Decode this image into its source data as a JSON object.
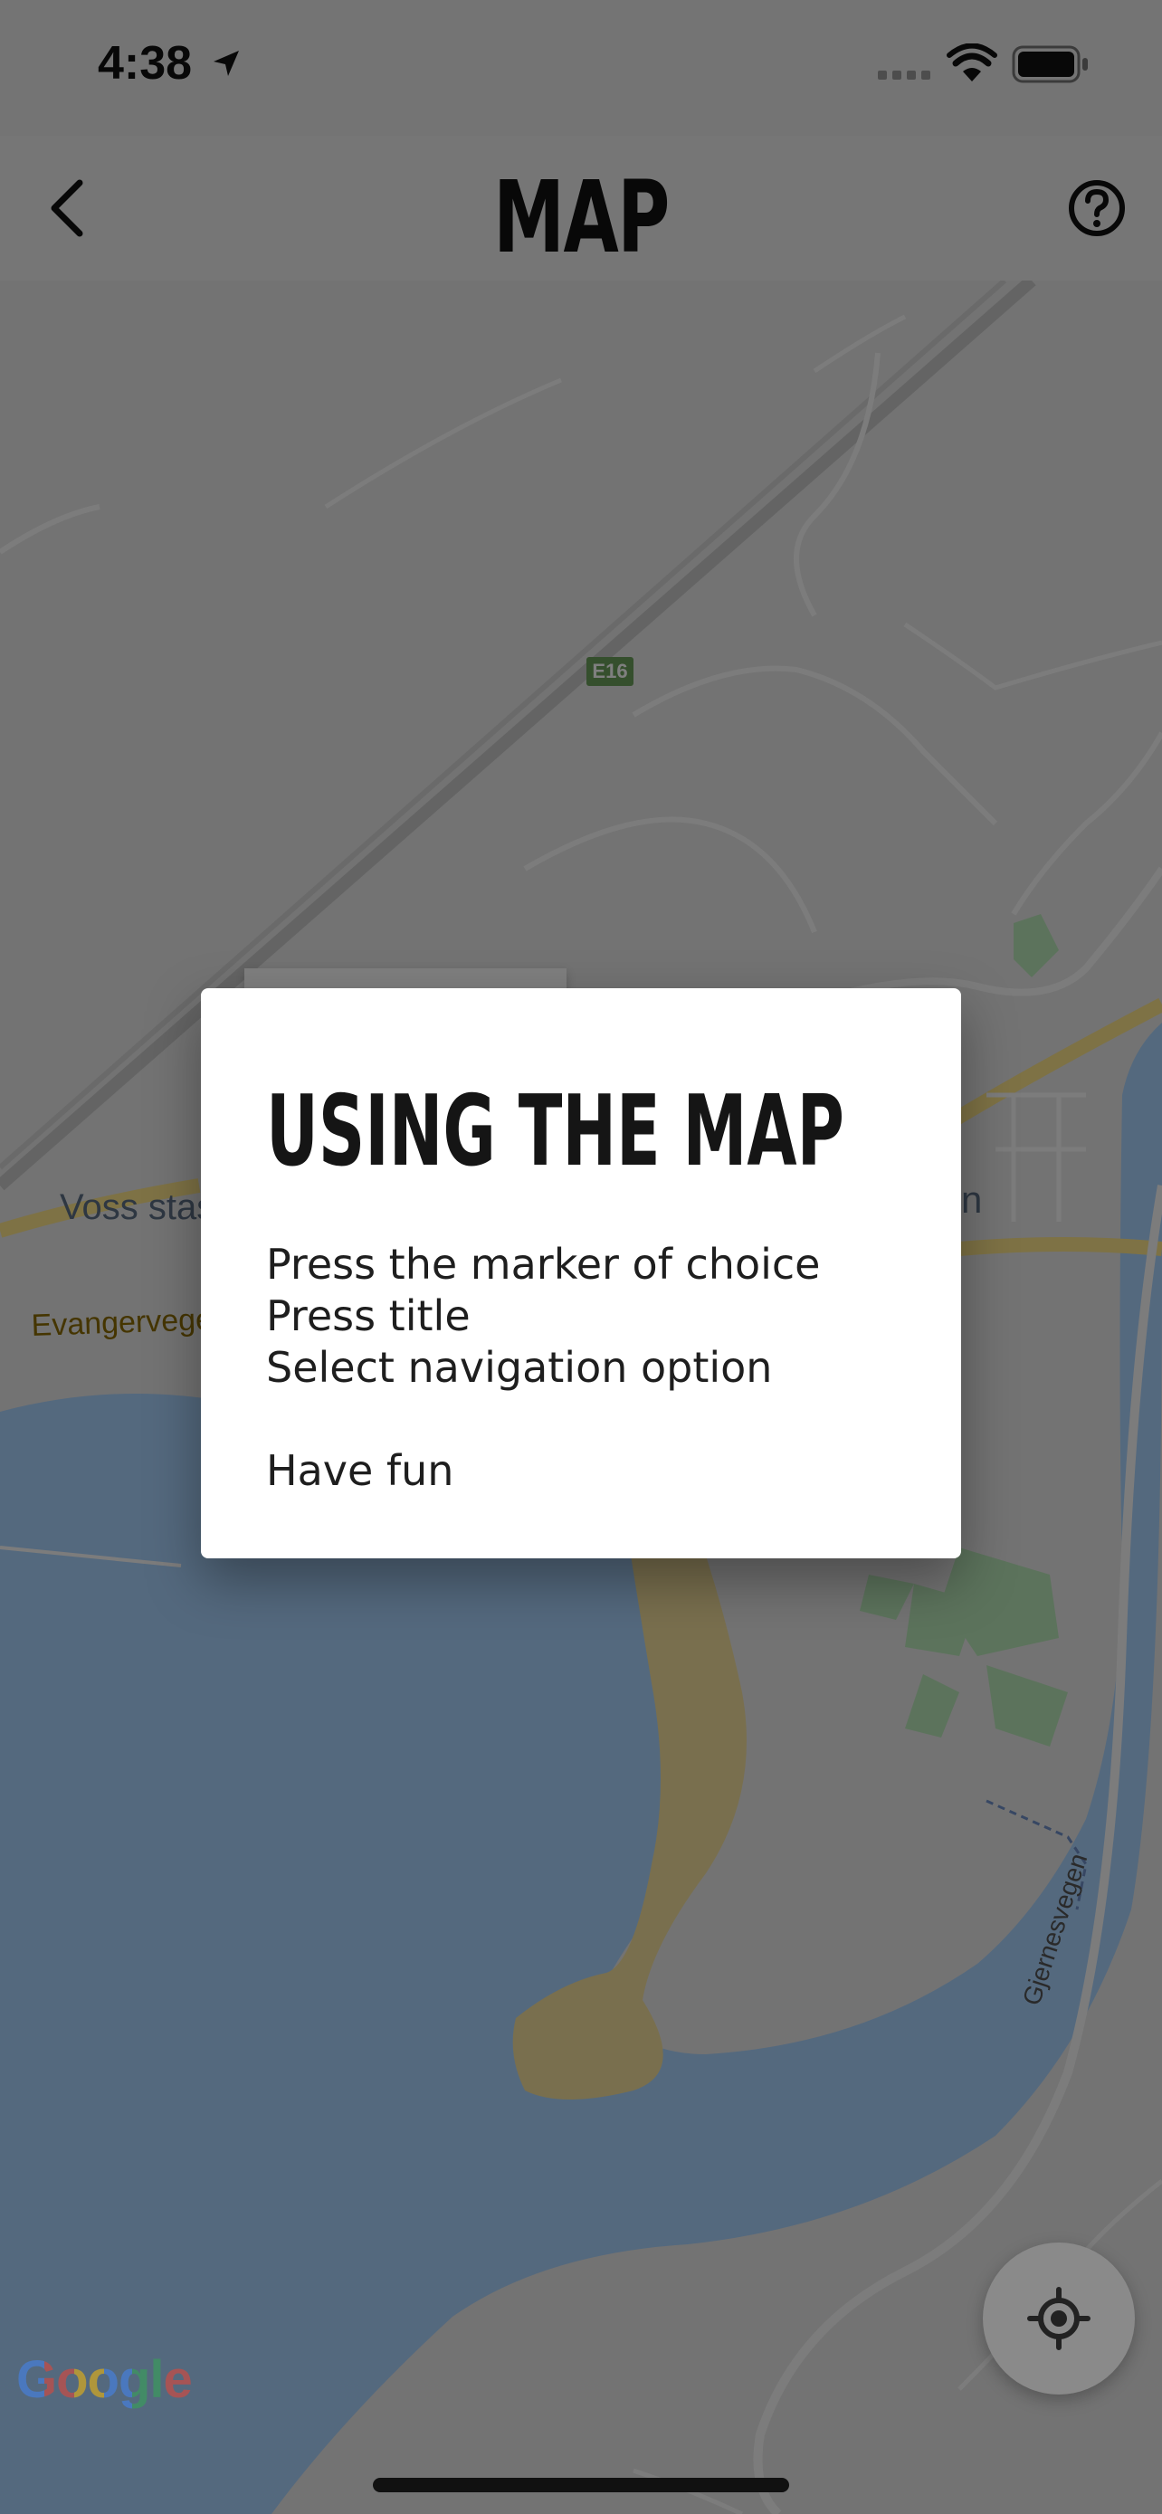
{
  "status": {
    "time": "4:38"
  },
  "header": {
    "title": "MAP",
    "back_icon": "chevron-left-icon",
    "help_icon": "help-circle-icon"
  },
  "map": {
    "road_badge": "E16",
    "labels": {
      "voss": "Voss stas",
      "evanger": "Evangervegen",
      "gjernes": "Gjernesvegen",
      "partial_n": "n"
    },
    "attribution": "Google",
    "locate_icon": "my-location-icon",
    "colors": {
      "water": "#a9d2fd",
      "land": "#e6e6e6",
      "park": "#b9e6b9",
      "sand": "#f3df9c",
      "road_major": "#fce58a"
    }
  },
  "dialog": {
    "title": "USING THE MAP",
    "lines": [
      "Press the marker of choice",
      "Press title",
      "Select navigation option"
    ],
    "footer": "Have fun"
  }
}
